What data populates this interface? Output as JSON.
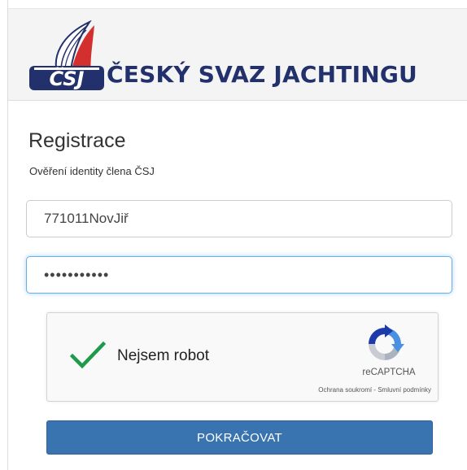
{
  "header": {
    "logo_text": "ČESKÝ SVAZ JACHTINGU",
    "logo_icon": "csj-sail-logo-icon"
  },
  "form": {
    "title": "Registrace",
    "subtitle": "Ověření identity člena ČSJ",
    "username_value": "771011NovJiř",
    "password_value": "•••••••••••",
    "submit_label": "POKRAČOVAT"
  },
  "captcha": {
    "label": "Nejsem robot",
    "brand": "reCAPTCHA",
    "links": "Ochrana soukromí - Smluvní podmínky",
    "checked": true,
    "check_icon": "checkmark-icon",
    "logo_icon": "recaptcha-logo-icon"
  },
  "colors": {
    "brand_navy": "#22306b",
    "sail_red": "#d32f2f",
    "button_blue": "#3a74b0",
    "check_green": "#1e9b4a",
    "focus_blue": "#66afe9"
  }
}
